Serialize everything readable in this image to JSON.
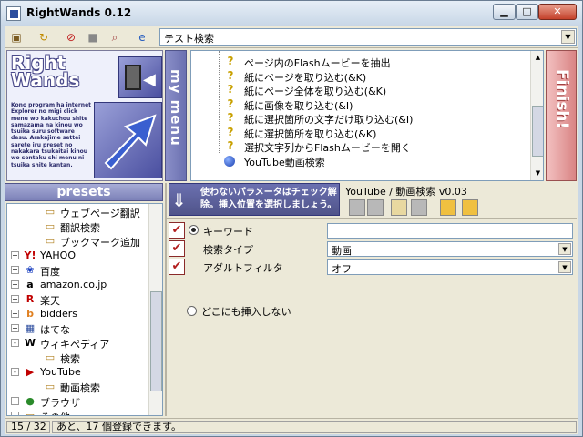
{
  "window": {
    "title": "RightWands 0.12"
  },
  "toolbar": {
    "search_engine": "テスト検索"
  },
  "logo": {
    "title_line1": "Right",
    "title_line2": "Wands",
    "description": "Kono program ha internet Explorer no migi click menu wo kakuchou shite samazama na kinou wo tsuika suru software desu. Arakajime settei sarete iru preset no nakakara tsukaitai kinou wo sentaku shi menu ni tsuika shite kantan."
  },
  "sidebar": {
    "my_menu_label": "my menu",
    "finish_label": "Finish!"
  },
  "menu_items": [
    {
      "label": "ページ内のFlashムービーを抽出",
      "icon": "question-icon"
    },
    {
      "label": "紙にページを取り込む(&K)",
      "icon": "question-icon"
    },
    {
      "label": "紙にページ全体を取り込む(&K)",
      "icon": "question-icon"
    },
    {
      "label": "紙に画像を取り込む(&I)",
      "icon": "question-icon"
    },
    {
      "label": "紙に選択箇所の文字だけ取り込む(&I)",
      "icon": "question-icon"
    },
    {
      "label": "紙に選択箇所を取り込む(&K)",
      "icon": "question-icon"
    },
    {
      "label": "選択文字列からFlashムービーを開く",
      "icon": "question-icon"
    },
    {
      "label": "YouTube動画検索",
      "icon": "blue-orb-icon"
    }
  ],
  "presets": {
    "header": "presets",
    "items": [
      {
        "label": "ウェブページ翻訳",
        "icon": "folder-icon",
        "level": 2,
        "expander": ""
      },
      {
        "label": "翻訳検索",
        "icon": "folder-icon",
        "level": 2,
        "expander": ""
      },
      {
        "label": "ブックマーク追加",
        "icon": "folder-icon",
        "level": 2,
        "expander": ""
      },
      {
        "label": "YAHOO",
        "icon": "yahoo-icon",
        "level": 1,
        "expander": "+"
      },
      {
        "label": "百度",
        "icon": "paw-icon",
        "level": 1,
        "expander": "+"
      },
      {
        "label": "amazon.co.jp",
        "icon": "amazon-icon",
        "level": 1,
        "expander": "+"
      },
      {
        "label": "楽天",
        "icon": "rakuten-icon",
        "level": 1,
        "expander": "+"
      },
      {
        "label": "bidders",
        "icon": "bidders-icon",
        "level": 1,
        "expander": "+"
      },
      {
        "label": "はてな",
        "icon": "hatena-icon",
        "level": 1,
        "expander": "+"
      },
      {
        "label": "ウィキペディア",
        "icon": "wikipedia-icon",
        "level": 1,
        "expander": "-"
      },
      {
        "label": "検索",
        "icon": "folder-icon",
        "level": 2,
        "expander": ""
      },
      {
        "label": "YouTube",
        "icon": "youtube-icon",
        "level": 1,
        "expander": "-"
      },
      {
        "label": "動画検索",
        "icon": "folder-icon",
        "level": 2,
        "expander": ""
      },
      {
        "label": "ブラウザ",
        "icon": "globe-icon",
        "level": 1,
        "expander": "+"
      },
      {
        "label": "その他",
        "icon": "folder-icon",
        "level": 1,
        "expander": "+"
      }
    ]
  },
  "hint": {
    "text": "使わないパラメータはチェック解除。挿入位置を選択しましょう。"
  },
  "preset_name": "YouTube / 動画検索 v0.03",
  "params": [
    {
      "label": "キーワード",
      "value": "",
      "type": "text",
      "radio": true,
      "selected": true,
      "checked": true
    },
    {
      "label": "検索タイプ",
      "value": "動画",
      "type": "select",
      "radio": false,
      "checked": true
    },
    {
      "label": "アダルトフィルタ",
      "value": "オフ",
      "type": "select",
      "radio": false,
      "checked": true
    }
  ],
  "no_insert_label": "どこにも挿入しない",
  "status": {
    "count": "15 / 32",
    "message": "あと、17 個登録できます。"
  }
}
